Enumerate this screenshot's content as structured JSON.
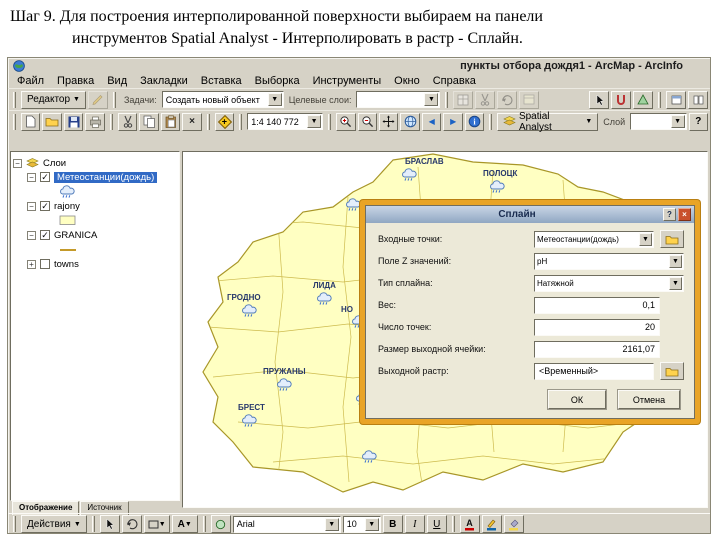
{
  "slide": {
    "title_line1": "Шаг 9. Для построения интерполированной поверхности выбираем на панели",
    "title_line2": "инструментов Spatial Analyst - Интерполировать в растр - Сплайн."
  },
  "window": {
    "title": "пункты отбора дождя1 - ArcMap - ArcInfo",
    "menus": [
      "Файл",
      "Правка",
      "Вид",
      "Закладки",
      "Вставка",
      "Выборка",
      "Инструменты",
      "Окно",
      "Справка"
    ]
  },
  "editor_toolbar": {
    "editor_label": "Редактор",
    "tasks_label": "Задачи:",
    "tasks_value": "Создать новый объект",
    "target_label": "Целевые слои:"
  },
  "standard_toolbar": {
    "scale_value": "1:4 140 772",
    "spatial_analyst_label": "Spatial Analyst",
    "layer_label": "Слой"
  },
  "toc": {
    "root_label": "Слои",
    "layers": [
      {
        "label": "Метеостанции(дождь)",
        "checked": true,
        "selected": true
      },
      {
        "label": "rajony",
        "checked": true,
        "selected": false
      },
      {
        "label": "GRANICA",
        "checked": true,
        "selected": false
      },
      {
        "label": "towns",
        "checked": false,
        "selected": false
      }
    ],
    "tabs": [
      "Отображение",
      "Источник"
    ]
  },
  "map_labels": [
    "БРАСЛАВ",
    "ПОЛОЦК",
    "ГРОДНО",
    "ЛИДА",
    "НО",
    "ПРУЖАНЫ",
    "БРЕСТ"
  ],
  "dialog": {
    "title": "Сплайн",
    "fields": [
      {
        "label": "Входные точки:",
        "value": "Метеостанции(дождь)"
      },
      {
        "label": "Поле Z значений:",
        "value": "pH"
      },
      {
        "label": "Тип сплайна:",
        "value": "Натяжной"
      },
      {
        "label": "Вес:",
        "value": "0,1"
      },
      {
        "label": "Число точек:",
        "value": "20"
      },
      {
        "label": "Размер выходной ячейки:",
        "value": "2161,07"
      },
      {
        "label": "Выходной растр:",
        "value": "<Временный>"
      }
    ],
    "ok_label": "ОК",
    "cancel_label": "Отмена"
  },
  "draw_toolbar": {
    "actions_label": "Действия",
    "font_value": "Arial",
    "size_value": "10",
    "bold_label": "B",
    "italic_label": "I",
    "underline_label": "U"
  },
  "colors": {
    "selection_blue": "#316ac5",
    "map_fill": "#ffffc2",
    "highlight_gold": "#e9a427",
    "close_red": "#c9502c"
  }
}
